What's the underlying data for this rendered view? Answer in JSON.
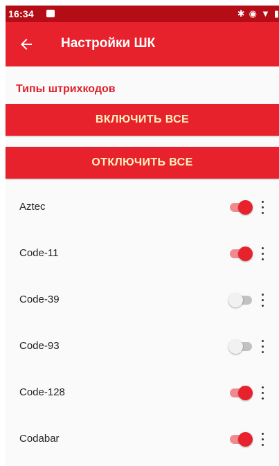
{
  "status_bar": {
    "time": "16:34",
    "icons": [
      "notification-icon",
      "bluetooth-icon",
      "vibrate-icon",
      "wifi-icon",
      "battery-icon"
    ]
  },
  "app_bar": {
    "title": "Настройки ШК",
    "back_icon": "arrow-left-icon"
  },
  "section": {
    "title": "Типы штрихкодов"
  },
  "buttons": {
    "enable_all": "ВКЛЮЧИТЬ ВСЕ",
    "disable_all": "ОТКЛЮЧИТЬ ВСЕ"
  },
  "barcodes": [
    {
      "name": "Aztec",
      "enabled": true
    },
    {
      "name": "Code-11",
      "enabled": true
    },
    {
      "name": "Code-39",
      "enabled": false
    },
    {
      "name": "Code-93",
      "enabled": false
    },
    {
      "name": "Code-128",
      "enabled": true
    },
    {
      "name": "Codabar",
      "enabled": true
    }
  ],
  "colors": {
    "accent": "#e8222d",
    "status_bar": "#b50d15",
    "button_text": "#fff3c0"
  }
}
